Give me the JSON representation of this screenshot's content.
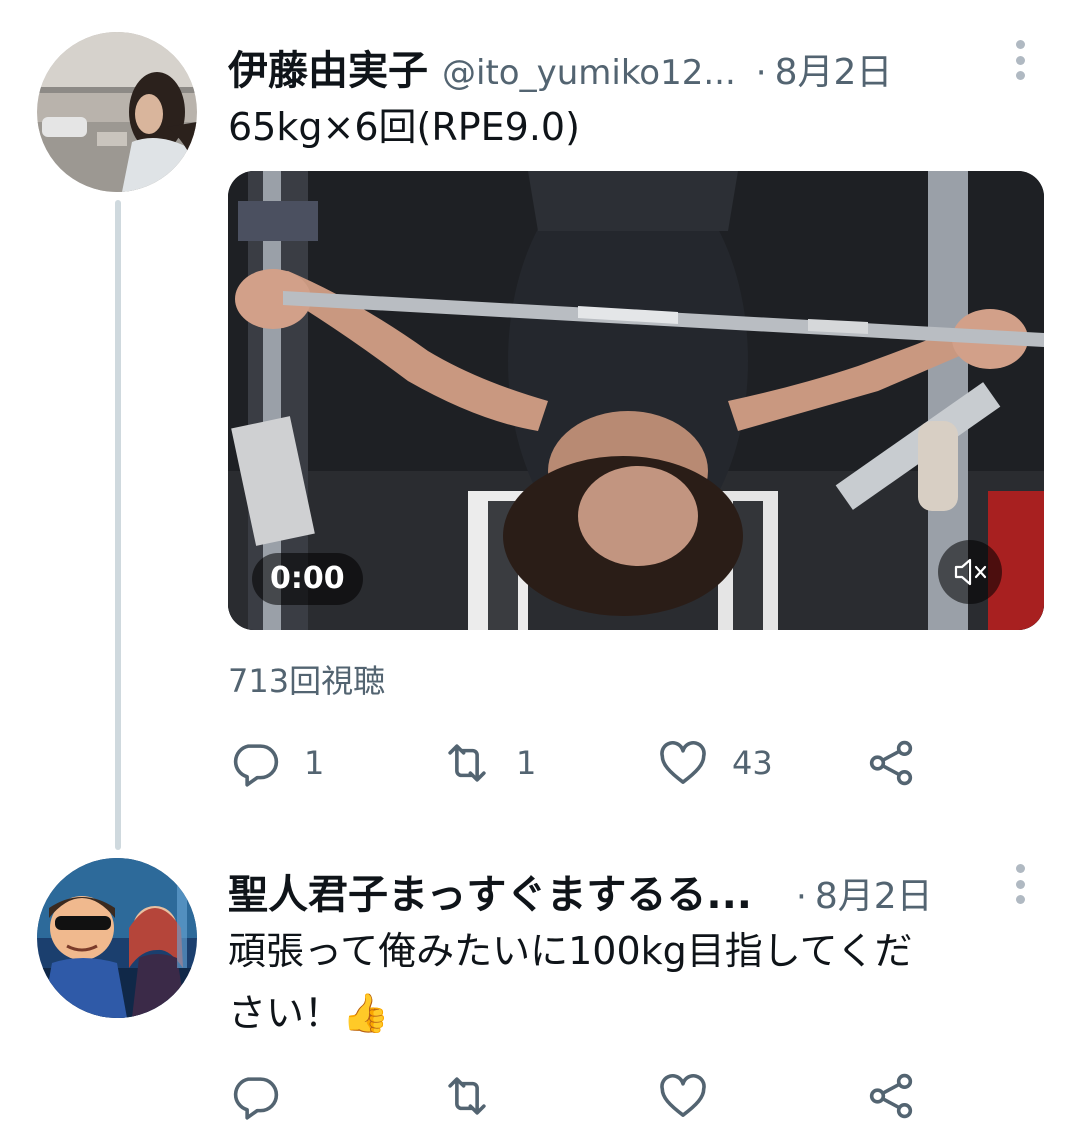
{
  "tweet": {
    "display_name": "伊藤由実子",
    "handle": "@ito_yumiko12...",
    "dot": "·",
    "date": "8月2日",
    "text": "65kg×6回(RPE9.0)",
    "video": {
      "timestamp": "0:00"
    },
    "views": "713回視聴",
    "counts": {
      "replies": "1",
      "retweets": "1",
      "likes": "43"
    }
  },
  "reply": {
    "display_name": "聖人君子まっすぐまするる...",
    "dot": "·",
    "date": "8月2日",
    "text_line1": "頑張って俺みたいに100kg目指してくだ",
    "text_line2": "さい！👍"
  },
  "icons": {
    "reply": "speech-bubble-icon",
    "retweet": "retweet-arrows-icon",
    "like": "heart-icon",
    "share": "share-icon",
    "mute": "speaker-muted-icon",
    "more": "vertical-ellipsis-icon"
  },
  "colors": {
    "text_primary": "#0f1419",
    "text_secondary": "#536471",
    "thread_line": "#cfd9de"
  }
}
